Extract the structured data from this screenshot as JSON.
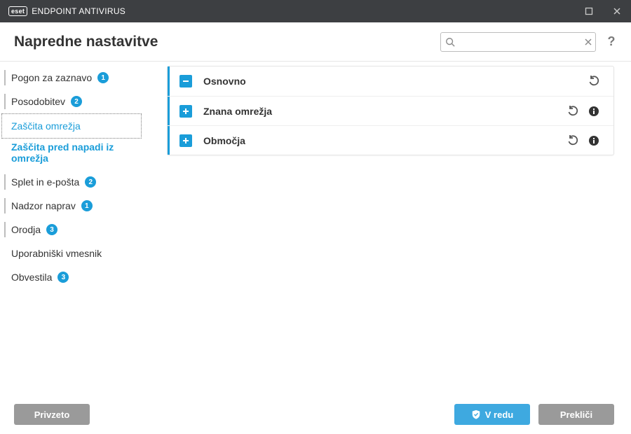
{
  "window": {
    "brand_logo_text": "eset",
    "brand_name": "ENDPOINT ANTIVIRUS"
  },
  "header": {
    "title": "Napredne nastavitve",
    "search_placeholder": "",
    "help_label": "?"
  },
  "sidebar": {
    "items": [
      {
        "label": "Pogon za zaznavo",
        "badge": "1"
      },
      {
        "label": "Posodobitev",
        "badge": "2"
      },
      {
        "label": "Zaščita omrežja"
      },
      {
        "label": "Zaščita pred napadi iz omrežja"
      },
      {
        "label": "Splet in e-pošta",
        "badge": "2"
      },
      {
        "label": "Nadzor naprav",
        "badge": "1"
      },
      {
        "label": "Orodja",
        "badge": "3"
      },
      {
        "label": "Uporabniški vmesnik"
      },
      {
        "label": "Obvestila",
        "badge": "3"
      }
    ]
  },
  "rows": [
    {
      "label": "Osnovno",
      "expanded": true
    },
    {
      "label": "Znana omrežja",
      "expanded": false
    },
    {
      "label": "Območja",
      "expanded": false
    }
  ],
  "footer": {
    "default_label": "Privzeto",
    "ok_label": "V redu",
    "cancel_label": "Prekliči"
  },
  "icons": {
    "search": "search-icon",
    "clear": "clear-icon",
    "revert": "revert-icon",
    "info": "info-icon",
    "shield": "shield-icon",
    "maximize": "maximize-icon",
    "close": "close-icon"
  }
}
